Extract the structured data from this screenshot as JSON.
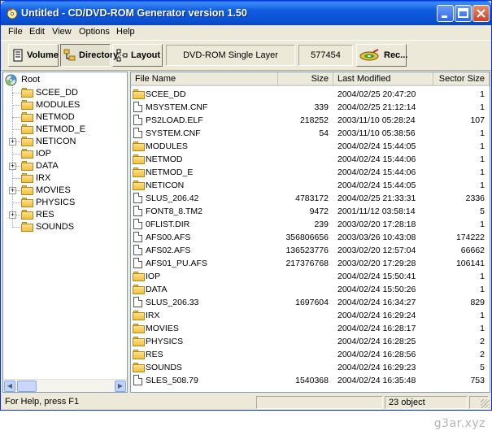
{
  "window": {
    "title": "Untitled - CD/DVD-ROM Generator version 1.50"
  },
  "menu": [
    "File",
    "Edit",
    "View",
    "Options",
    "Help"
  ],
  "toolbar": {
    "volume_label": "Volume",
    "directory_label": "Directory",
    "layout_label": "Layout",
    "media_type": "DVD-ROM Single Layer",
    "size_value": "577454",
    "record_label": "Rec..."
  },
  "tree": {
    "root_label": "Root",
    "items": [
      {
        "label": "SCEE_DD",
        "expandable": false
      },
      {
        "label": "MODULES",
        "expandable": false
      },
      {
        "label": "NETMOD",
        "expandable": false
      },
      {
        "label": "NETMOD_E",
        "expandable": false
      },
      {
        "label": "NETICON",
        "expandable": true
      },
      {
        "label": "IOP",
        "expandable": false
      },
      {
        "label": "DATA",
        "expandable": true
      },
      {
        "label": "IRX",
        "expandable": false
      },
      {
        "label": "MOVIES",
        "expandable": true
      },
      {
        "label": "PHYSICS",
        "expandable": false
      },
      {
        "label": "RES",
        "expandable": true
      },
      {
        "label": "SOUNDS",
        "expandable": false
      }
    ]
  },
  "list": {
    "columns": [
      "File Name",
      "Size",
      "Last Modified",
      "Sector Size"
    ],
    "rows": [
      {
        "type": "folder",
        "name": "SCEE_DD",
        "size": "",
        "modified": "2004/02/25 20:47:20",
        "sectors": "1"
      },
      {
        "type": "file",
        "name": "MSYSTEM.CNF",
        "size": "339",
        "modified": "2004/02/25 21:12:14",
        "sectors": "1"
      },
      {
        "type": "file",
        "name": "PS2LOAD.ELF",
        "size": "218252",
        "modified": "2003/11/10 05:28:24",
        "sectors": "107"
      },
      {
        "type": "file",
        "name": "SYSTEM.CNF",
        "size": "54",
        "modified": "2003/11/10 05:38:56",
        "sectors": "1"
      },
      {
        "type": "folder",
        "name": "MODULES",
        "size": "",
        "modified": "2004/02/24 15:44:05",
        "sectors": "1"
      },
      {
        "type": "folder",
        "name": "NETMOD",
        "size": "",
        "modified": "2004/02/24 15:44:06",
        "sectors": "1"
      },
      {
        "type": "folder",
        "name": "NETMOD_E",
        "size": "",
        "modified": "2004/02/24 15:44:06",
        "sectors": "1"
      },
      {
        "type": "folder",
        "name": "NETICON",
        "size": "",
        "modified": "2004/02/24 15:44:05",
        "sectors": "1"
      },
      {
        "type": "file",
        "name": "SLUS_206.42",
        "size": "4783172",
        "modified": "2004/02/25 21:33:31",
        "sectors": "2336"
      },
      {
        "type": "file",
        "name": "FONT8_8.TM2",
        "size": "9472",
        "modified": "2001/11/12 03:58:14",
        "sectors": "5"
      },
      {
        "type": "file",
        "name": "0FLIST.DIR",
        "size": "239",
        "modified": "2003/02/20 17:28:18",
        "sectors": "1"
      },
      {
        "type": "file",
        "name": "AFS00.AFS",
        "size": "356806656",
        "modified": "2003/03/26 10:43:08",
        "sectors": "174222"
      },
      {
        "type": "file",
        "name": "AFS02.AFS",
        "size": "136523776",
        "modified": "2003/02/20 12:57:04",
        "sectors": "66662"
      },
      {
        "type": "file",
        "name": "AFS01_PU.AFS",
        "size": "217376768",
        "modified": "2003/02/20 17:29:28",
        "sectors": "106141"
      },
      {
        "type": "folder",
        "name": "IOP",
        "size": "",
        "modified": "2004/02/24 15:50:41",
        "sectors": "1"
      },
      {
        "type": "folder",
        "name": "DATA",
        "size": "",
        "modified": "2004/02/24 15:50:26",
        "sectors": "1"
      },
      {
        "type": "file",
        "name": "SLUS_206.33",
        "size": "1697604",
        "modified": "2004/02/24 16:34:27",
        "sectors": "829"
      },
      {
        "type": "folder",
        "name": "IRX",
        "size": "",
        "modified": "2004/02/24 16:29:24",
        "sectors": "1"
      },
      {
        "type": "folder",
        "name": "MOVIES",
        "size": "",
        "modified": "2004/02/24 16:28:17",
        "sectors": "1"
      },
      {
        "type": "folder",
        "name": "PHYSICS",
        "size": "",
        "modified": "2004/02/24 16:28:25",
        "sectors": "2"
      },
      {
        "type": "folder",
        "name": "RES",
        "size": "",
        "modified": "2004/02/24 16:28:56",
        "sectors": "2"
      },
      {
        "type": "folder",
        "name": "SOUNDS",
        "size": "",
        "modified": "2004/02/24 16:29:23",
        "sectors": "5"
      },
      {
        "type": "file",
        "name": "SLES_508.79",
        "size": "1540368",
        "modified": "2004/02/24 16:35:48",
        "sectors": "753"
      }
    ]
  },
  "status": {
    "help_text": "For Help, press F1",
    "object_count": "23 object"
  },
  "watermark": "g3ar.xyz",
  "colors": {
    "titlebar": "#0a5fe8",
    "folder": "#f0c040",
    "window_bg": "#ece9d8"
  }
}
